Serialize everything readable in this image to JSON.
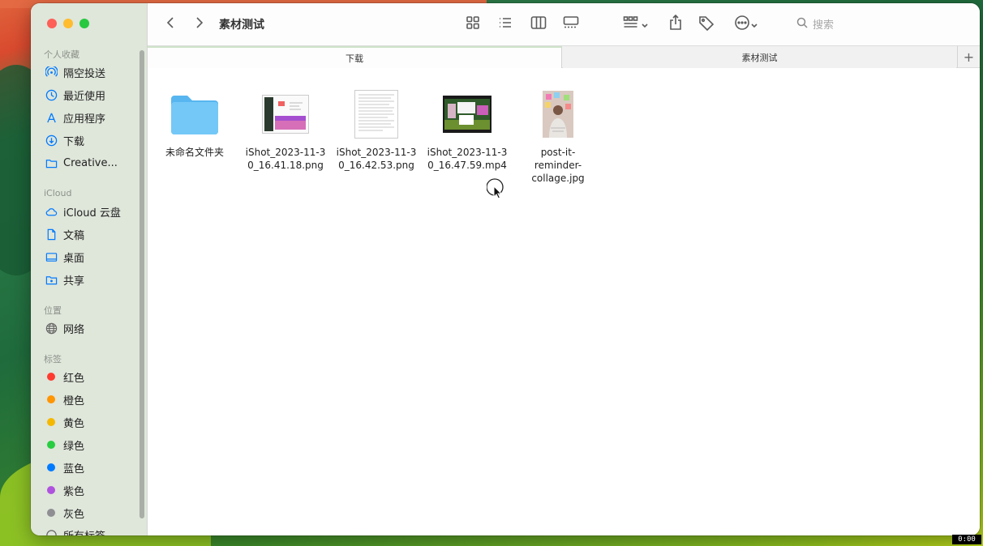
{
  "window": {
    "title": "素材测试",
    "search_placeholder": "搜索"
  },
  "sidebar": {
    "sections": [
      {
        "header": "个人收藏",
        "items": [
          {
            "label": "隔空投送",
            "icon": "airdrop-icon"
          },
          {
            "label": "最近使用",
            "icon": "clock-icon"
          },
          {
            "label": "应用程序",
            "icon": "applications-icon"
          },
          {
            "label": "下载",
            "icon": "download-icon"
          },
          {
            "label": "Creative...",
            "icon": "folder-icon"
          }
        ]
      },
      {
        "header": "iCloud",
        "items": [
          {
            "label": "iCloud 云盘",
            "icon": "icloud-icon"
          },
          {
            "label": "文稿",
            "icon": "document-icon"
          },
          {
            "label": "桌面",
            "icon": "desktop-icon"
          },
          {
            "label": "共享",
            "icon": "shared-folder-icon"
          }
        ]
      },
      {
        "header": "位置",
        "items": [
          {
            "label": "网络",
            "icon": "network-icon"
          }
        ]
      },
      {
        "header": "标签",
        "items": [
          {
            "label": "红色",
            "color": "#ff3b30"
          },
          {
            "label": "橙色",
            "color": "#ff9500"
          },
          {
            "label": "黄色",
            "color": "#ffcc00"
          },
          {
            "label": "绿色",
            "color": "#28cd41"
          },
          {
            "label": "蓝色",
            "color": "#007aff"
          },
          {
            "label": "紫色",
            "color": "#af52de"
          },
          {
            "label": "灰色",
            "color": "#8e8e93"
          },
          {
            "label": "所有标签",
            "icon": "all-tags-icon"
          }
        ]
      }
    ]
  },
  "tabs": [
    {
      "label": "下载"
    },
    {
      "label": "素材测试"
    }
  ],
  "files": [
    {
      "name": "未命名文件夹",
      "type": "folder"
    },
    {
      "name": "iShot_2023-11-30_16.41.18.png",
      "type": "png"
    },
    {
      "name": "iShot_2023-11-30_16.42.53.png",
      "type": "png"
    },
    {
      "name": "iShot_2023-11-30_16.47.59.mp4",
      "type": "video"
    },
    {
      "name": "post-it-reminder-collage.jpg",
      "type": "jpg"
    }
  ],
  "recording": {
    "timer": "0:00"
  },
  "colors": {
    "accent": "#007aff",
    "sidebar_bg": "#dfe6da"
  }
}
